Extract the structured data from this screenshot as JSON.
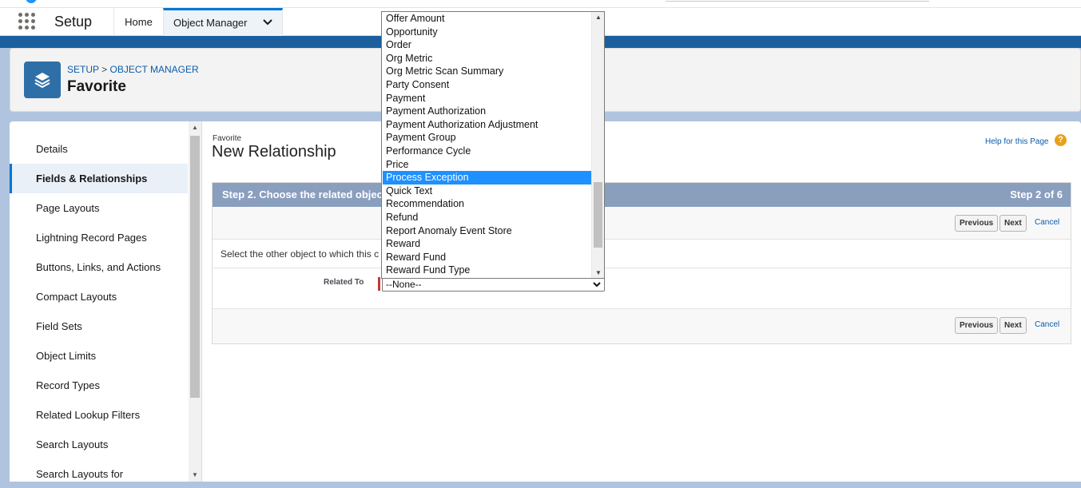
{
  "nav": {
    "app_name": "Setup",
    "home_tab": "Home",
    "object_manager_tab": "Object Manager"
  },
  "header": {
    "breadcrumb_setup": "SETUP",
    "breadcrumb_separator": ">",
    "breadcrumb_object_manager": "OBJECT MANAGER",
    "title": "Favorite"
  },
  "sidebar": {
    "items": [
      {
        "label": "Details"
      },
      {
        "label": "Fields & Relationships"
      },
      {
        "label": "Page Layouts"
      },
      {
        "label": "Lightning Record Pages"
      },
      {
        "label": "Buttons, Links, and Actions"
      },
      {
        "label": "Compact Layouts"
      },
      {
        "label": "Field Sets"
      },
      {
        "label": "Object Limits"
      },
      {
        "label": "Record Types"
      },
      {
        "label": "Related Lookup Filters"
      },
      {
        "label": "Search Layouts"
      },
      {
        "label": "Search Layouts for"
      }
    ],
    "active_index": 1
  },
  "content": {
    "object_name": "Favorite",
    "title": "New Relationship",
    "help_link": "Help for this Page",
    "help_icon_glyph": "?",
    "step_label": "Step 2. Choose the related objec",
    "step_count": "Step 2 of 6",
    "previous_label": "Previous",
    "next_label": "Next",
    "cancel_label": "Cancel",
    "instruction": "Select the other object to which this c",
    "related_to_label": "Related To",
    "related_to_value": "--None--"
  },
  "dropdown": {
    "options": [
      "Offer Amount",
      "Opportunity",
      "Order",
      "Org Metric",
      "Org Metric Scan Summary",
      "Party Consent",
      "Payment",
      "Payment Authorization",
      "Payment Authorization Adjustment",
      "Payment Group",
      "Performance Cycle",
      "Price",
      "Process Exception",
      "Quick Text",
      "Recommendation",
      "Refund",
      "Report Anomaly Event Store",
      "Reward",
      "Reward Fund",
      "Reward Fund Type"
    ],
    "highlighted": "Process Exception"
  },
  "colors": {
    "brand_blue": "#1b5f9e",
    "link": "#0b5cab",
    "step_header": "#8a9ebe",
    "highlight": "#1e90ff",
    "required": "#c23934"
  }
}
